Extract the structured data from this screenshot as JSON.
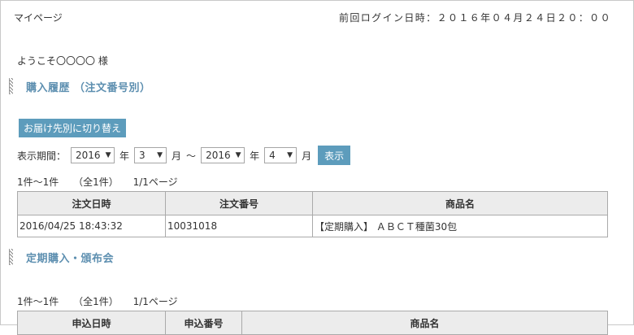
{
  "header": {
    "page_name": "マイページ",
    "last_login": "前回ログイン日時：２０１６年０４月２４日２０：００"
  },
  "welcome": "ようこそ〇〇〇〇 様",
  "purchase_section": {
    "title": "購入履歴 （注文番号別）",
    "switch_button": "お届け先別に切り替え",
    "period_label": "表示期間：",
    "from_year": "2016",
    "from_month": "3",
    "to_year": "2016",
    "to_month": "4",
    "year_unit": "年",
    "month_unit": "月",
    "tilde": "～",
    "show_button": "表示",
    "count_range": "1件～1件",
    "count_total": "（全1件）",
    "count_page": "1/1ページ",
    "columns": [
      "注文日時",
      "注文番号",
      "商品名"
    ],
    "rows": [
      [
        "2016/04/25 18:43:32",
        "10031018",
        "【定期購入】 ＡＢＣＴ種菌30包"
      ]
    ]
  },
  "subscription_section": {
    "title": "定期購入・頒布会",
    "count_range": "1件～1件",
    "count_total": "（全1件）",
    "count_page": "1/1ページ",
    "columns": [
      "申込日時",
      "申込番号",
      "商品名"
    ]
  }
}
